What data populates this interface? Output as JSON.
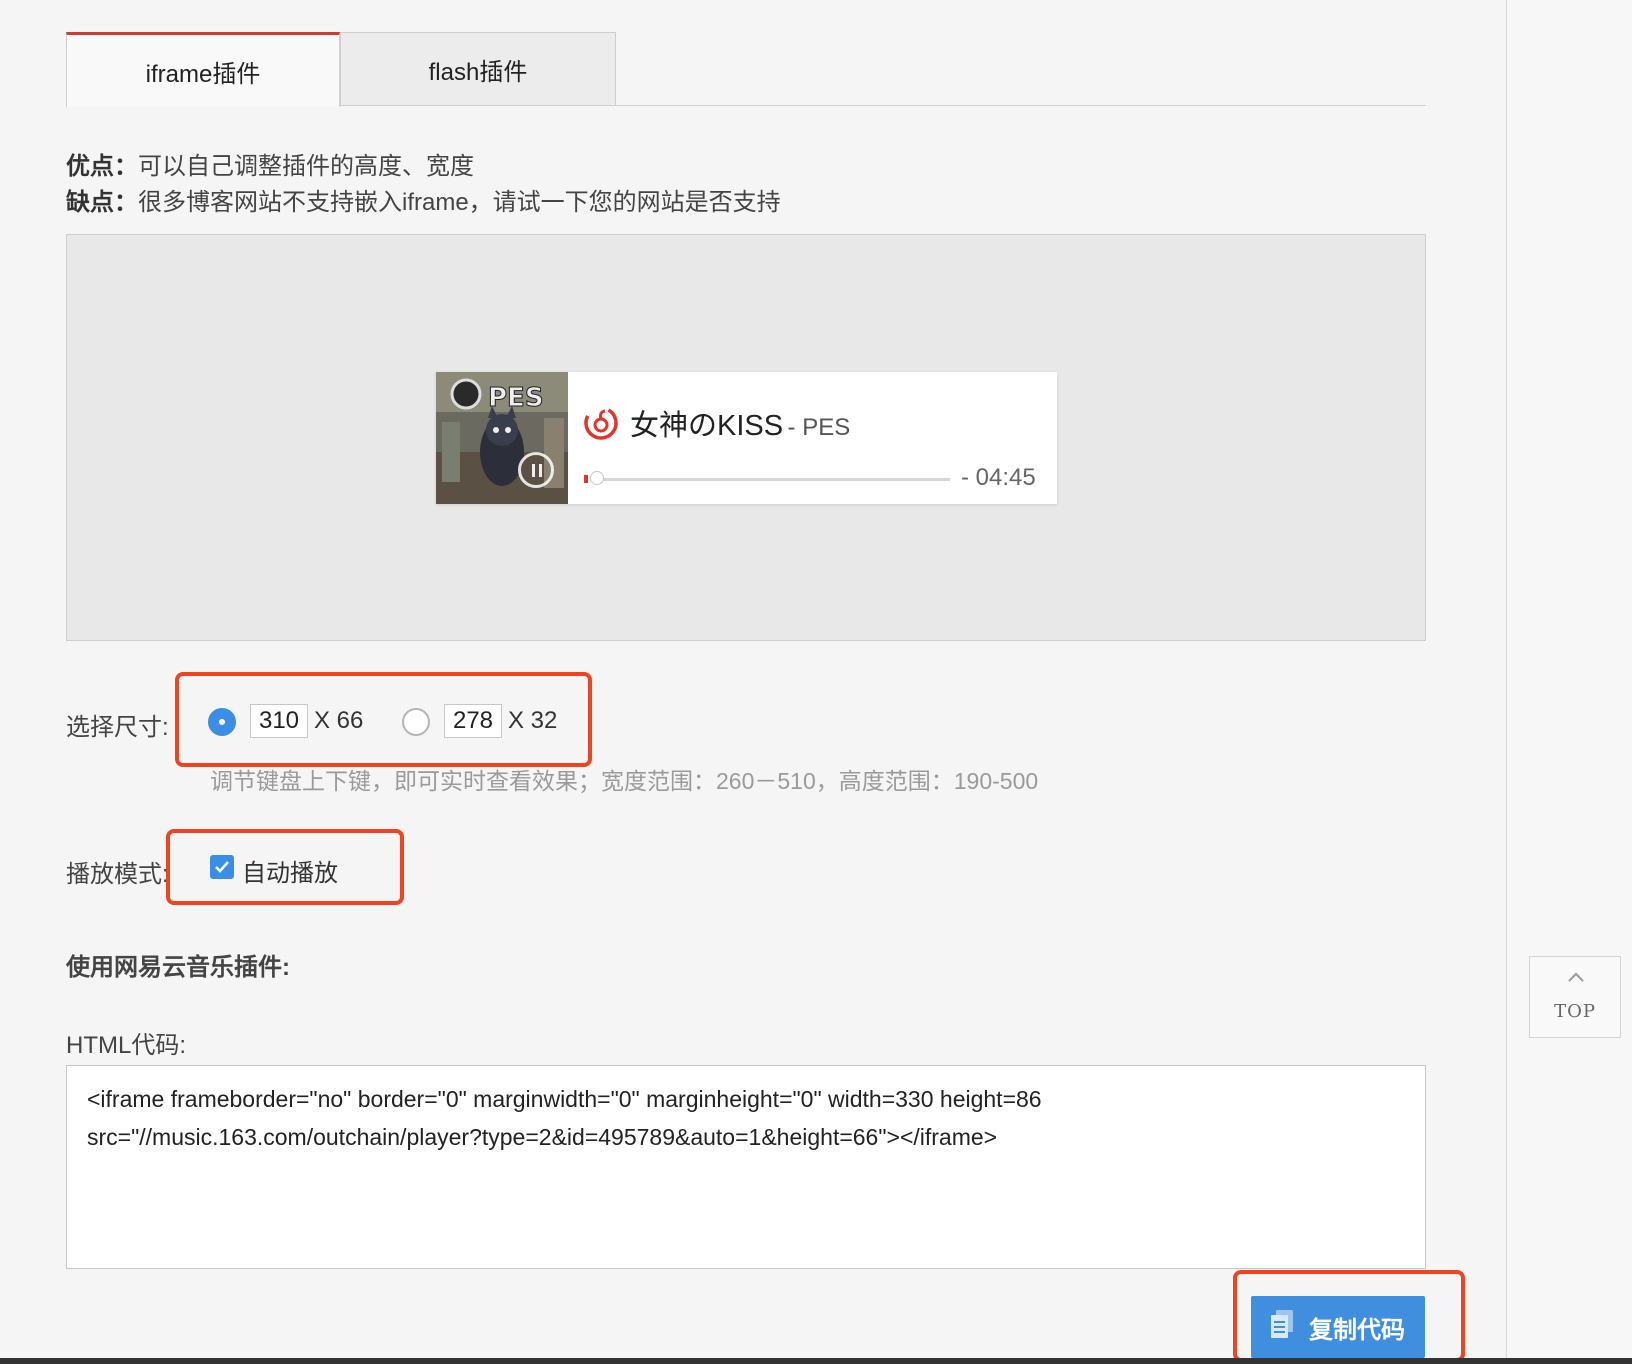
{
  "tabs": [
    {
      "label": "iframe插件",
      "active": true
    },
    {
      "label": "flash插件",
      "active": false
    }
  ],
  "info": {
    "pros_label": "优点：",
    "pros_text": "可以自己调整插件的高度、宽度",
    "cons_label": "缺点：",
    "cons_text": "很多博客网站不支持嵌入iframe，请试一下您的网站是否支持"
  },
  "player": {
    "title": "女神のKISS",
    "artist": "- PES",
    "time": "- 04:45",
    "progress": 0.0,
    "state": "playing"
  },
  "size": {
    "label": "选择尺寸:",
    "options": [
      {
        "width": "310",
        "height": "X 66",
        "selected": true
      },
      {
        "width": "278",
        "height": "X 32",
        "selected": false
      }
    ],
    "hint": "调节键盘上下键，即可实时查看效果；宽度范围：260－510，高度范围：190-500"
  },
  "mode": {
    "label": "播放模式:",
    "autoplay_label": "自动播放",
    "autoplay_checked": true
  },
  "usage_title": "使用网易云音乐插件:",
  "html_code": {
    "label": "HTML代码:",
    "line1": "<iframe frameborder=\"no\" border=\"0\" marginwidth=\"0\" marginheight=\"0\" width=330 height=86",
    "line2": "src=\"//music.163.com/outchain/player?type=2&id=495789&auto=1&height=66\"></iframe>"
  },
  "copy_button": {
    "label": "复制代码",
    "icon": "document-icon"
  },
  "top_button": {
    "label": "TOP",
    "icon": "chevron-up-icon"
  },
  "colors": {
    "accent_red": "#d33a31",
    "highlight_orange": "#ee4420",
    "button_blue": "#3f8fde",
    "radio_blue": "#3a8ee6"
  }
}
